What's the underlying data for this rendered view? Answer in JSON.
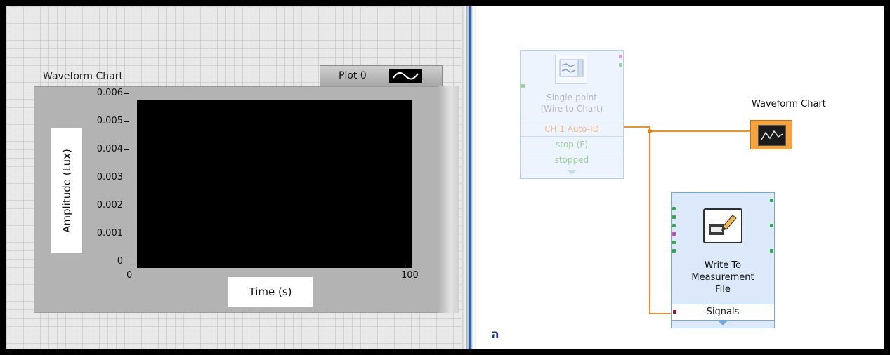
{
  "front_panel": {
    "chart_label": "Waveform Chart",
    "legend": {
      "plot_name": "Plot 0"
    },
    "y_axis": {
      "label": "Amplitude (Lux)",
      "ticks": [
        "0.006",
        "0.005",
        "0.004",
        "0.003",
        "0.002",
        "0.001",
        "0"
      ]
    },
    "x_axis": {
      "label": "Time (s)",
      "ticks": [
        "0",
        "100"
      ]
    }
  },
  "block_diagram": {
    "daq_node": {
      "title_line1": "Single-point",
      "title_line2": "(Wire to Chart)",
      "terminals": [
        "CH 1 Auto-ID",
        "stop (F)",
        "stopped"
      ]
    },
    "chart_terminal": {
      "label": "Waveform Chart"
    },
    "write_node": {
      "title_lines": [
        "Write To",
        "Measurement",
        "File"
      ],
      "input_label": "Signals"
    },
    "corner_glyph": "ה"
  },
  "colors": {
    "wire": "#f38f24",
    "daq_terminal_text": "#f6b98a",
    "stop_text": "#9ccf9c"
  },
  "icons": [
    "daq-assistant-icon",
    "waveform-chart-terminal-icon",
    "write-file-icon",
    "plot-line-icon"
  ],
  "chart_data": {
    "type": "line",
    "title": "Waveform Chart",
    "xlabel": "Time (s)",
    "ylabel": "Amplitude (Lux)",
    "xlim": [
      0,
      100
    ],
    "ylim": [
      0,
      0.006
    ],
    "x_ticks": [
      0,
      100
    ],
    "y_ticks": [
      0,
      0.001,
      0.002,
      0.003,
      0.004,
      0.005,
      0.006
    ],
    "series": [
      {
        "name": "Plot 0",
        "values": []
      }
    ],
    "legend": "top-right"
  }
}
